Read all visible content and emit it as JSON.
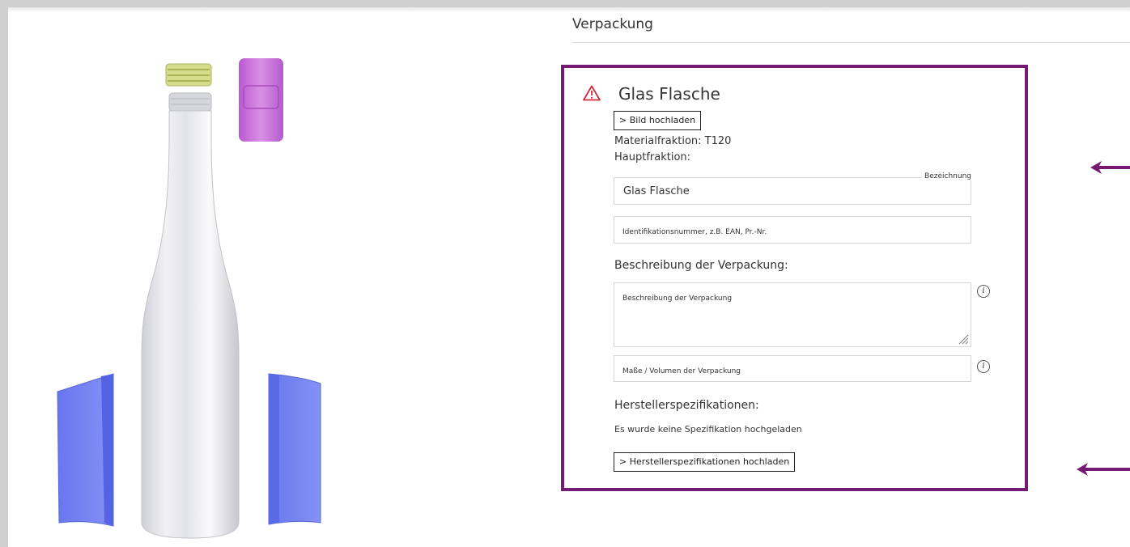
{
  "section": {
    "title": "Verpackung"
  },
  "card": {
    "title": "Glas Flasche",
    "upload_image_label": "> Bild hochladen",
    "material_fraction": "Materialfraktion: T120",
    "main_fraction": "Hauptfraktion:",
    "name_field": {
      "legend": "Bezeichnung",
      "value": "Glas Flasche"
    },
    "id_field": {
      "placeholder": "Identifikationsnummer, z.B. EAN, Pr.-Nr."
    },
    "description_heading": "Beschreibung der Verpackung:",
    "description_field": {
      "placeholder": "Beschreibung der Verpackung"
    },
    "dimensions_field": {
      "placeholder": "Maße / Volumen der Verpackung"
    },
    "info_glyph": "i",
    "manufacturer_heading": "Herstellerspezifikationen:",
    "no_spec_text": "Es wurde keine Spezifikation hochgeladen",
    "upload_spec_label": "> Herstellerspezifikationen hochladen"
  },
  "colors": {
    "accent": "#741a72",
    "warning": "#d0273d",
    "sleeve": "#6f7ff2",
    "cap_green": "#c8d66a",
    "cap_purple": "#c76fd6"
  },
  "icons": [
    "warning-icon",
    "info-icon",
    "resize-grip-icon",
    "arrow-left-icon"
  ]
}
